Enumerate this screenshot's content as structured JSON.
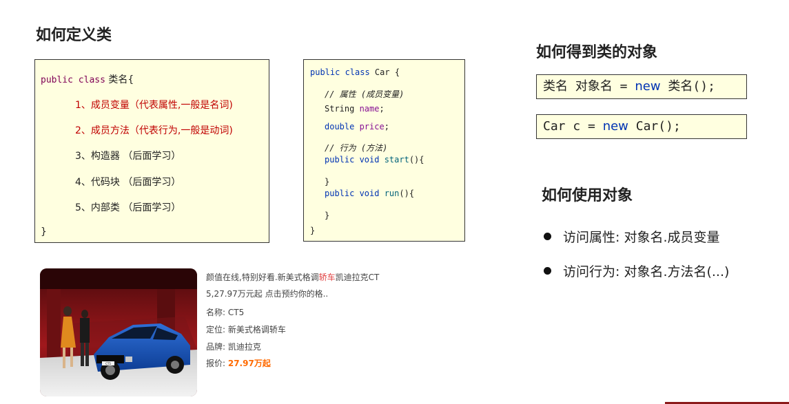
{
  "headings": {
    "define_class": "如何定义类",
    "get_object": "如何得到类的对象",
    "use_object": "如何使用对象"
  },
  "class_box": {
    "public_class_kw": "public class",
    "class_name": " 类名{",
    "item1": "1、成员变量（代表属性,一般是名词)",
    "item2": "2、成员方法（代表行为,一般是动词)",
    "item3": "3、构造器 （后面学习）",
    "item4": "4、代码块 （后面学习）",
    "item5": "5、内部类 （后面学习）",
    "close": "}"
  },
  "car_box": {
    "l1_kw": "public class",
    "l1_rest": " Car {",
    "comment1": "// 属性 (成员变量)",
    "l3_type": "String ",
    "l3_field": "name",
    "l3_end": ";",
    "l4_type": "double ",
    "l4_field": "price",
    "l4_end": ";",
    "comment2": "// 行为 (方法)",
    "l6_kw": "public void ",
    "l6_name": "start",
    "l6_end": "(){",
    "l7": "}",
    "l8_kw": "public void ",
    "l8_name": "run",
    "l8_end": "(){",
    "l9": "}",
    "close": "}"
  },
  "snippets": {
    "s1_pre": "类名 对象名 = ",
    "s1_new": "new",
    "s1_post": " 类名();",
    "s2_pre": "Car c = ",
    "s2_new": "new",
    "s2_post": " Car();"
  },
  "bullets": {
    "b1": "访问属性:  对象名.成员变量",
    "b2": "访问行为:  对象名.方法名(...)"
  },
  "ad": {
    "line1_pre": "颜值在线,特别好看.新美式格调",
    "line1_hl": "轿车",
    "line1_post": "凯迪拉克CT",
    "line2": "5,27.97万元起 点击预约你的格..",
    "name": "名称:  CT5",
    "position": "定位:  新美式格调轿车",
    "brand": "品牌:  凯迪拉克",
    "price_label": "报价:  ",
    "price_value": "27.97万起",
    "plate": "CT5"
  },
  "colors": {
    "box_background": "#ffffe0",
    "keyword_purple": "#7f0055",
    "red_text": "#c00000",
    "keyword_blue": "#0033b3",
    "price_orange": "#ff6a00"
  }
}
